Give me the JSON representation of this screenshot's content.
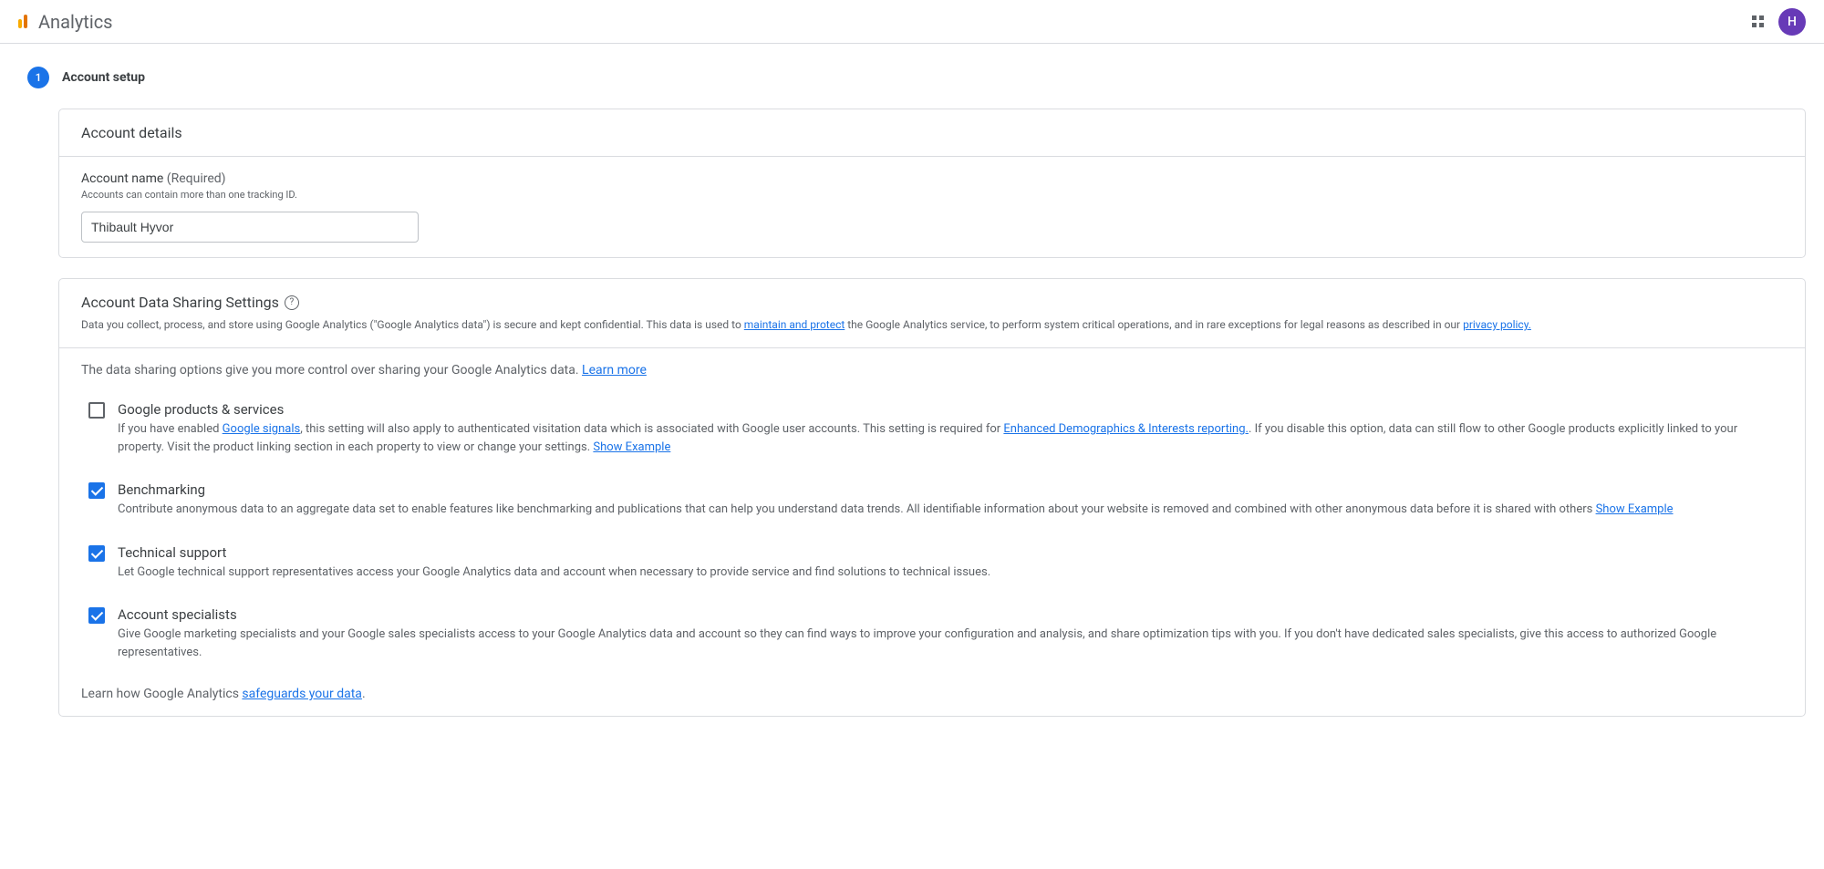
{
  "header": {
    "app_title": "Analytics",
    "avatar_letter": "H"
  },
  "step": {
    "number": "1",
    "title": "Account setup"
  },
  "account_details": {
    "panel_title": "Account details",
    "name_label": "Account name",
    "name_required": " (Required)",
    "name_hint": "Accounts can contain more than one tracking ID.",
    "name_value": "Thibault Hyvor"
  },
  "sharing": {
    "panel_title": "Account Data Sharing Settings",
    "desc_pre": "Data you collect, process, and store using Google Analytics (\"Google Analytics data\") is secure and kept confidential. This data is used to ",
    "desc_link1": "maintain and protect",
    "desc_mid": " the Google Analytics service, to perform system critical operations, and in rare exceptions for legal reasons as described in our ",
    "desc_link2": "privacy policy.",
    "intro_pre": "The data sharing options give you more control over sharing your Google Analytics data. ",
    "intro_link": "Learn more",
    "options": [
      {
        "title": "Google products & services",
        "desc_pre": "If you have enabled ",
        "desc_link1": "Google signals",
        "desc_mid": ", this setting will also apply to authenticated visitation data which is associated with Google user accounts. This setting is required for ",
        "desc_link2": "Enhanced Demographics & Interests reporting.",
        "desc_post": ". If you disable this option, data can still flow to other Google products explicitly linked to your property. Visit the product linking section in each property to view or change your settings. ",
        "show_example": "Show Example",
        "checked": false
      },
      {
        "title": "Benchmarking",
        "desc_pre": "Contribute anonymous data to an aggregate data set to enable features like benchmarking and publications that can help you understand data trends. All identifiable information about your website is removed and combined with other anonymous data before it is shared with others ",
        "show_example": "Show Example",
        "checked": true
      },
      {
        "title": "Technical support",
        "desc_pre": "Let Google technical support representatives access your Google Analytics data and account when necessary to provide service and find solutions to technical issues.",
        "checked": true
      },
      {
        "title": "Account specialists",
        "desc_pre": "Give Google marketing specialists and your Google sales specialists access to your Google Analytics data and account so they can find ways to improve your configuration and analysis, and share optimization tips with you. If you don't have dedicated sales specialists, give this access to authorized Google representatives.",
        "checked": true
      }
    ],
    "footer_pre": "Learn how Google Analytics ",
    "footer_link": "safeguards your data",
    "footer_post": "."
  }
}
